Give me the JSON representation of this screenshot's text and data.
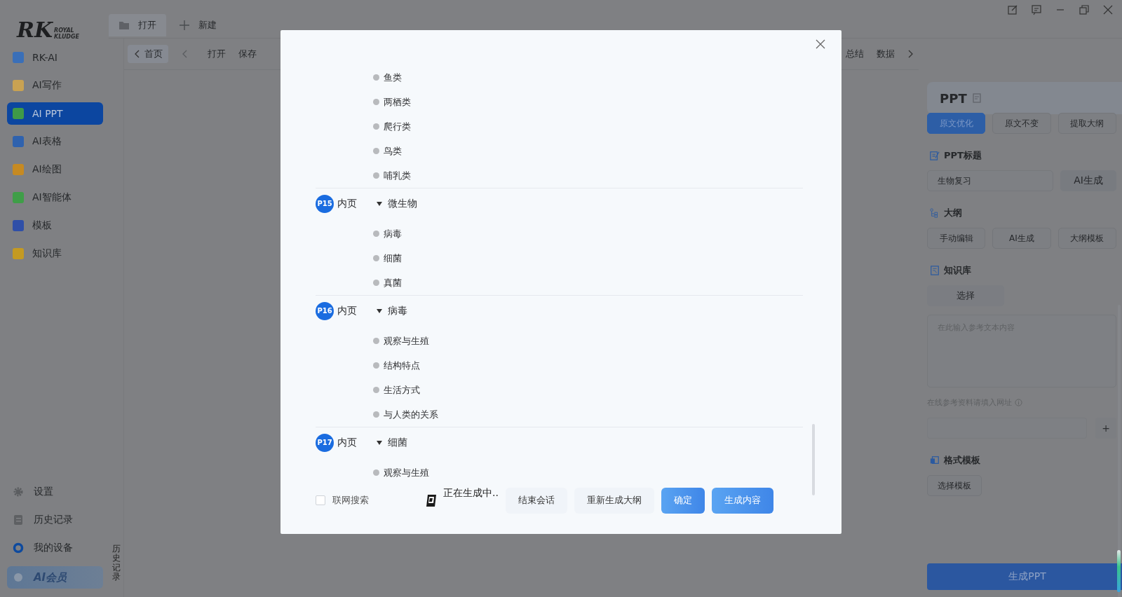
{
  "sidebar": {
    "logo": {
      "mark": "RK",
      "line1": "ROYAL",
      "line2": "KLUDGE"
    },
    "items": [
      {
        "label": "RK-AI",
        "color": "#3a6fb8",
        "selected": false
      },
      {
        "label": "AI写作",
        "color": "#c9a252",
        "selected": false
      },
      {
        "label": "AI PPT",
        "color": "#3f9a48",
        "selected": true
      },
      {
        "label": "AI表格",
        "color": "#2f62ae",
        "selected": false
      },
      {
        "label": "AI绘图",
        "color": "#c68a22",
        "selected": false
      },
      {
        "label": "AI智能体",
        "color": "#3f9e48",
        "selected": false
      },
      {
        "label": "模板",
        "color": "#2f4fa8",
        "selected": false
      },
      {
        "label": "知识库",
        "color": "#c49a22",
        "selected": false
      }
    ],
    "bottom": [
      {
        "kind": "settings",
        "label": "设置"
      },
      {
        "kind": "history",
        "label": "历史记录"
      },
      {
        "kind": "device",
        "label": "我的设备"
      },
      {
        "kind": "member",
        "label": "AI会员"
      }
    ]
  },
  "history_tab": "历史记录",
  "tabs": [
    {
      "label": "打开",
      "selected": true
    },
    {
      "label": "新建",
      "selected": false
    }
  ],
  "toolbar": {
    "home": "首页",
    "items": [
      "打开",
      "保存"
    ],
    "right_items": [
      "总结",
      "数据"
    ]
  },
  "panel": {
    "title": "PPT",
    "modes": [
      {
        "label": "原文优化",
        "selected": true
      },
      {
        "label": "原文不变",
        "selected": false
      },
      {
        "label": "提取大纲",
        "selected": false
      }
    ],
    "title_section": {
      "heading": "PPT标题",
      "value": "生物复习",
      "button": "AI生成"
    },
    "outline_section": {
      "heading": "大纲",
      "buttons": [
        "手动编辑",
        "AI生成",
        "大纲模板"
      ]
    },
    "knowledge": {
      "heading": "知识库",
      "button": "选择",
      "placeholder": "在此输入参考文本内容",
      "url_label": "在线参考资料请填入网址",
      "add": "+"
    },
    "template": {
      "heading": "格式模板",
      "button": "选择模板"
    },
    "generate": "生成PPT"
  },
  "dialog": {
    "outline": [
      {
        "kind": "tail",
        "children": [
          {
            "title": "鱼类"
          },
          {
            "title": "两栖类"
          },
          {
            "title": "爬行类"
          },
          {
            "title": "鸟类"
          },
          {
            "title": "哺乳类"
          }
        ]
      },
      {
        "kind": "page",
        "badge": "P15",
        "page_type": "内页",
        "title": "微生物",
        "expanded": true,
        "children": [
          {
            "title": "病毒"
          },
          {
            "title": "细菌"
          },
          {
            "title": "真菌"
          }
        ]
      },
      {
        "kind": "page",
        "badge": "P16",
        "page_type": "内页",
        "title": "病毒",
        "expanded": true,
        "children": [
          {
            "title": "观察与生殖"
          },
          {
            "title": "结构特点"
          },
          {
            "title": "生活方式"
          },
          {
            "title": "与人类的关系"
          }
        ]
      },
      {
        "kind": "page",
        "badge": "P17",
        "page_type": "内页",
        "title": "细菌",
        "expanded": true,
        "children": [
          {
            "title": "观察与生殖"
          }
        ]
      }
    ],
    "web_search": {
      "label": "联网搜索",
      "checked": false
    },
    "status": "正在生成中..",
    "buttons": [
      {
        "label": "结束会话",
        "kind": "plain"
      },
      {
        "label": "重新生成大纲",
        "kind": "plain"
      },
      {
        "label": "确定",
        "kind": "primary"
      },
      {
        "label": "生成内容",
        "kind": "primary"
      }
    ]
  }
}
